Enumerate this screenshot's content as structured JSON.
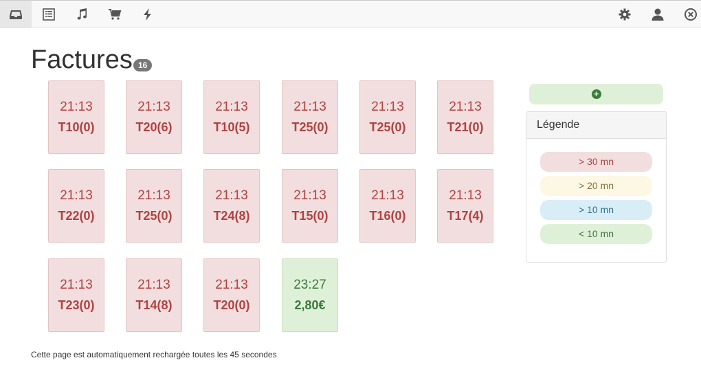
{
  "nav": {
    "left": [
      {
        "name": "inbox-icon",
        "active": true
      },
      {
        "name": "list-icon",
        "active": false
      },
      {
        "name": "music-icon",
        "active": false
      },
      {
        "name": "cart-icon",
        "active": false
      },
      {
        "name": "bolt-icon",
        "active": false
      }
    ],
    "right": [
      "gear-icon",
      "user-icon",
      "close-circle-icon"
    ]
  },
  "page": {
    "title": "Factures",
    "count": "16"
  },
  "cards": [
    {
      "time": "21:13",
      "label": "T10(0)",
      "status": "red"
    },
    {
      "time": "21:13",
      "label": "T20(6)",
      "status": "red"
    },
    {
      "time": "21:13",
      "label": "T10(5)",
      "status": "red"
    },
    {
      "time": "21:13",
      "label": "T25(0)",
      "status": "red"
    },
    {
      "time": "21:13",
      "label": "T25(0)",
      "status": "red"
    },
    {
      "time": "21:13",
      "label": "T21(0)",
      "status": "red"
    },
    {
      "time": "21:13",
      "label": "T22(0)",
      "status": "red"
    },
    {
      "time": "21:13",
      "label": "T25(0)",
      "status": "red"
    },
    {
      "time": "21:13",
      "label": "T24(8)",
      "status": "red"
    },
    {
      "time": "21:13",
      "label": "T15(0)",
      "status": "red"
    },
    {
      "time": "21:13",
      "label": "T16(0)",
      "status": "red"
    },
    {
      "time": "21:13",
      "label": "T17(4)",
      "status": "red"
    },
    {
      "time": "21:13",
      "label": "T23(0)",
      "status": "red"
    },
    {
      "time": "21:13",
      "label": "T14(8)",
      "status": "red"
    },
    {
      "time": "21:13",
      "label": "T20(0)",
      "status": "red"
    },
    {
      "time": "23:27",
      "label": "2,80€",
      "status": "green"
    }
  ],
  "legend": {
    "title": "Légende",
    "items": [
      {
        "label": "> 30 mn",
        "bg": "#f2dede",
        "color": "#a94442"
      },
      {
        "label": "> 20 mn",
        "bg": "#fcf8e3",
        "color": "#8a6d3b"
      },
      {
        "label": "> 10 mn",
        "bg": "#d9edf7",
        "color": "#31708f"
      },
      {
        "label": "< 10 mn",
        "bg": "#dff0d8",
        "color": "#3c763d"
      }
    ]
  },
  "footer": {
    "text": "Cette page est automatiquement rechargée toutes les 45 secondes"
  }
}
